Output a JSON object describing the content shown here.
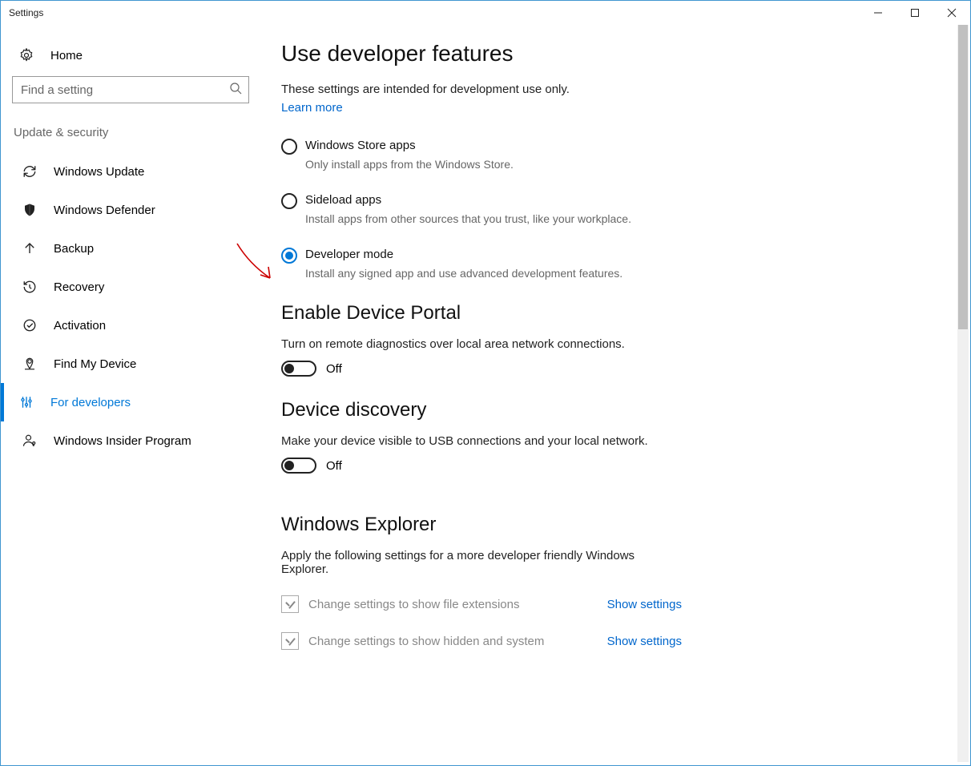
{
  "window": {
    "title": "Settings"
  },
  "left": {
    "home": "Home",
    "search_placeholder": "Find a setting",
    "section": "Update & security",
    "items": [
      {
        "label": "Windows Update"
      },
      {
        "label": "Windows Defender"
      },
      {
        "label": "Backup"
      },
      {
        "label": "Recovery"
      },
      {
        "label": "Activation"
      },
      {
        "label": "Find My Device"
      },
      {
        "label": "For developers"
      },
      {
        "label": "Windows Insider Program"
      }
    ]
  },
  "main": {
    "heading": "Use developer features",
    "intro": "These settings are intended for development use only.",
    "learn_more": "Learn more",
    "radios": [
      {
        "label": "Windows Store apps",
        "desc": "Only install apps from the Windows Store."
      },
      {
        "label": "Sideload apps",
        "desc": "Install apps from other sources that you trust, like your workplace."
      },
      {
        "label": "Developer mode",
        "desc": "Install any signed app and use advanced development features."
      }
    ],
    "portal": {
      "heading": "Enable Device Portal",
      "desc": "Turn on remote diagnostics over local area network connections.",
      "toggle": "Off"
    },
    "discovery": {
      "heading": "Device discovery",
      "desc": "Make your device visible to USB connections and your local network.",
      "toggle": "Off"
    },
    "explorer": {
      "heading": "Windows Explorer",
      "desc": "Apply the following settings for a more developer friendly Windows Explorer.",
      "rows": [
        {
          "label": "Change settings to show file extensions",
          "link": "Show settings"
        },
        {
          "label": "Change settings to show hidden and system",
          "link": "Show settings"
        }
      ]
    }
  }
}
